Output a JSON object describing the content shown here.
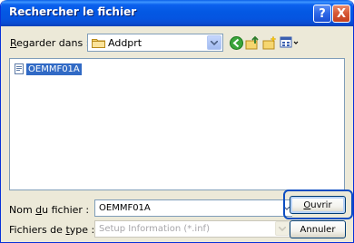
{
  "window": {
    "title": "Rechercher le fichier"
  },
  "titlebar": {
    "help_label": "?",
    "close_label": "X"
  },
  "look_in": {
    "label_prefix": "",
    "label_hotkey": "R",
    "label_rest": "egarder dans :",
    "value": "Addprt"
  },
  "toolbar": {
    "back_icon": "back-arrow-icon",
    "up_icon": "up-folder-icon",
    "new_folder_icon": "new-folder-icon",
    "view_icon": "view-menu-icon"
  },
  "file_list": {
    "items": [
      {
        "name": "OEMMF01A",
        "selected": true
      }
    ]
  },
  "file_name": {
    "label_prefix": "Nom ",
    "label_hotkey": "d",
    "label_rest": "u fichier :",
    "value": "OEMMF01A"
  },
  "file_type": {
    "label_prefix": "Fichiers de ",
    "label_hotkey": "t",
    "label_rest": "ype :",
    "value": "Setup Information (*.inf)"
  },
  "buttons": {
    "open_hotkey": "O",
    "open_rest": "uvrir",
    "cancel_label": "Annuler"
  },
  "colors": {
    "titlebar": "#0458e3",
    "dialog_bg": "#ece9d8",
    "selection": "#316ac5",
    "highlight_ring": "#0d4ec2"
  }
}
